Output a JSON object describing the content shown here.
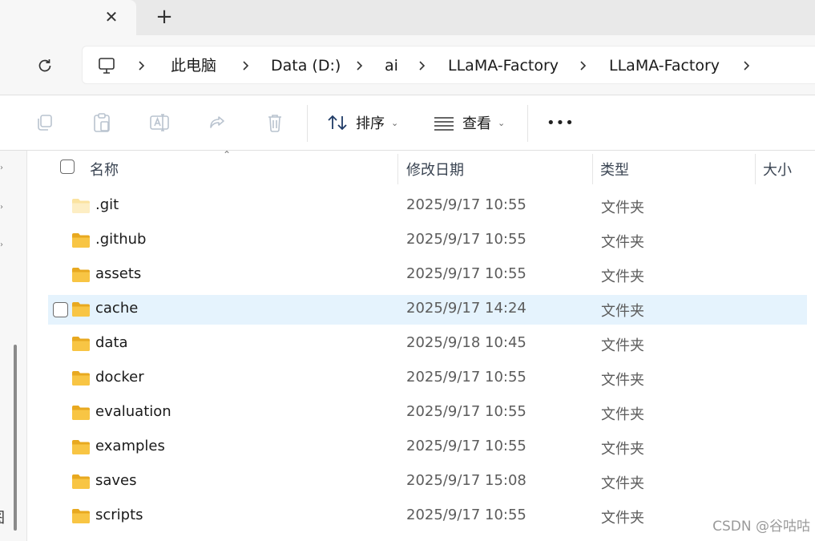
{
  "tabs": {
    "close_glyph": "✕",
    "new_glyph": "+"
  },
  "address": {
    "crumbs": [
      "此电脑",
      "Data (D:)",
      "ai",
      "LLaMA-Factory",
      "LLaMA-Factory"
    ]
  },
  "toolbar": {
    "sort_label": "排序",
    "view_label": "查看",
    "more_label": "•••"
  },
  "columns": {
    "name": "名称",
    "date_modified": "修改日期",
    "type": "类型",
    "size": "大小"
  },
  "files": [
    {
      "name": ".git",
      "date": "2025/9/17 10:55",
      "type": "文件夹"
    },
    {
      "name": ".github",
      "date": "2025/9/17 10:55",
      "type": "文件夹"
    },
    {
      "name": "assets",
      "date": "2025/9/17 10:55",
      "type": "文件夹"
    },
    {
      "name": "cache",
      "date": "2025/9/17 14:24",
      "type": "文件夹"
    },
    {
      "name": "data",
      "date": "2025/9/18 10:45",
      "type": "文件夹"
    },
    {
      "name": "docker",
      "date": "2025/9/17 10:55",
      "type": "文件夹"
    },
    {
      "name": "evaluation",
      "date": "2025/9/17 10:55",
      "type": "文件夹"
    },
    {
      "name": "examples",
      "date": "2025/9/17 10:55",
      "type": "文件夹"
    },
    {
      "name": "saves",
      "date": "2025/9/17 15:08",
      "type": "文件夹"
    },
    {
      "name": "scripts",
      "date": "2025/9/17 10:55",
      "type": "文件夹"
    }
  ],
  "nav": {
    "cut_glyph": "图"
  },
  "watermark": "CSDN @谷咕咕",
  "colors": {
    "accent": "#1a73e8",
    "selection": "#e5f3fd",
    "folder": "#f8c544"
  }
}
